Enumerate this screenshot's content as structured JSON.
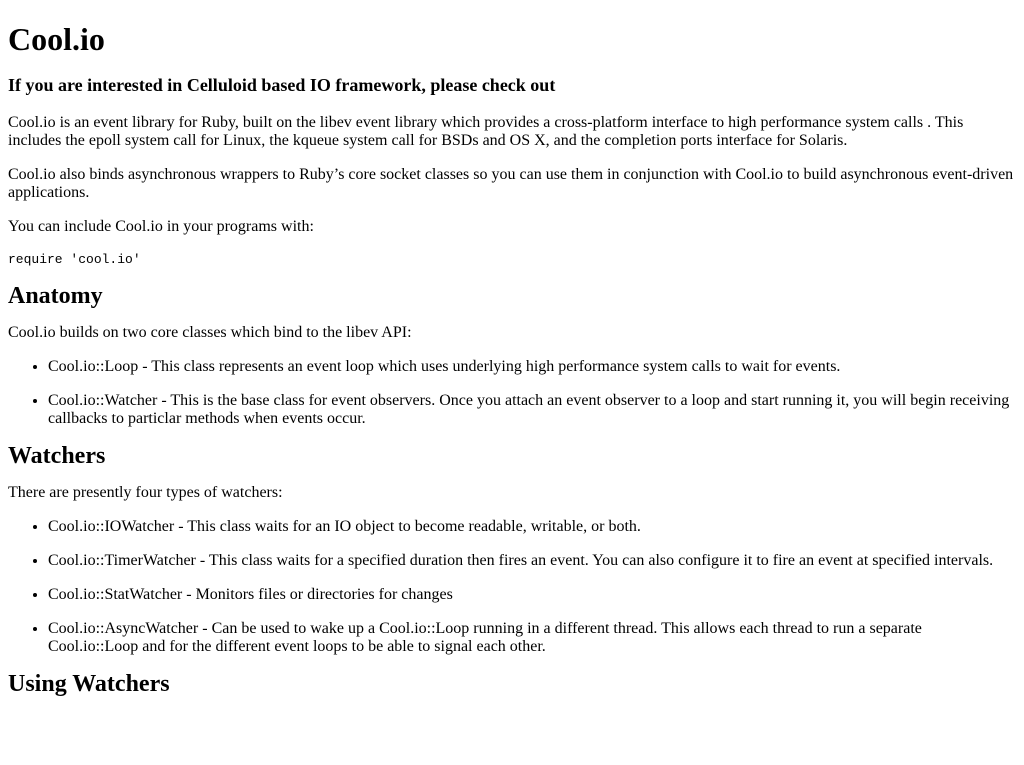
{
  "title": "Cool.io",
  "subtitle": "If you are interested in Celluloid based IO framework, please check out",
  "intro": {
    "p1": "Cool.io is an event library for Ruby, built on the libev event library which provides a cross-platform interface to high performance system calls . This includes the epoll system call for Linux, the kqueue system call for BSDs and OS X, and the completion ports interface for Solaris.",
    "p2": "Cool.io also binds asynchronous wrappers to Ruby’s core socket classes so you can use them in conjunction with Cool.io to build asynchronous event-driven applications.",
    "p3": "You can include Cool.io in your programs with:",
    "code": "require 'cool.io'"
  },
  "anatomy": {
    "heading": "Anatomy",
    "intro": "Cool.io builds on two core classes which bind to the libev API:",
    "items": [
      "Cool.io::Loop - This class represents an event loop which uses underlying high performance system calls to wait for events.",
      "Cool.io::Watcher - This is the base class for event observers. Once you attach an event observer to a loop and start running it, you will begin receiving callbacks to particlar methods when events occur."
    ]
  },
  "watchers": {
    "heading": "Watchers",
    "intro": "There are presently four types of watchers:",
    "items": [
      "Cool.io::IOWatcher - This class waits for an IO object to become readable, writable, or both.",
      "Cool.io::TimerWatcher - This class waits for a specified duration then fires an event. You can also configure it to fire an event at specified intervals.",
      "Cool.io::StatWatcher - Monitors files or directories for changes",
      "Cool.io::AsyncWatcher - Can be used to wake up a Cool.io::Loop running in a different thread. This allows each thread to run a separate Cool.io::Loop and for the different event loops to be able to signal each other."
    ]
  },
  "using_watchers": {
    "heading": "Using Watchers"
  }
}
